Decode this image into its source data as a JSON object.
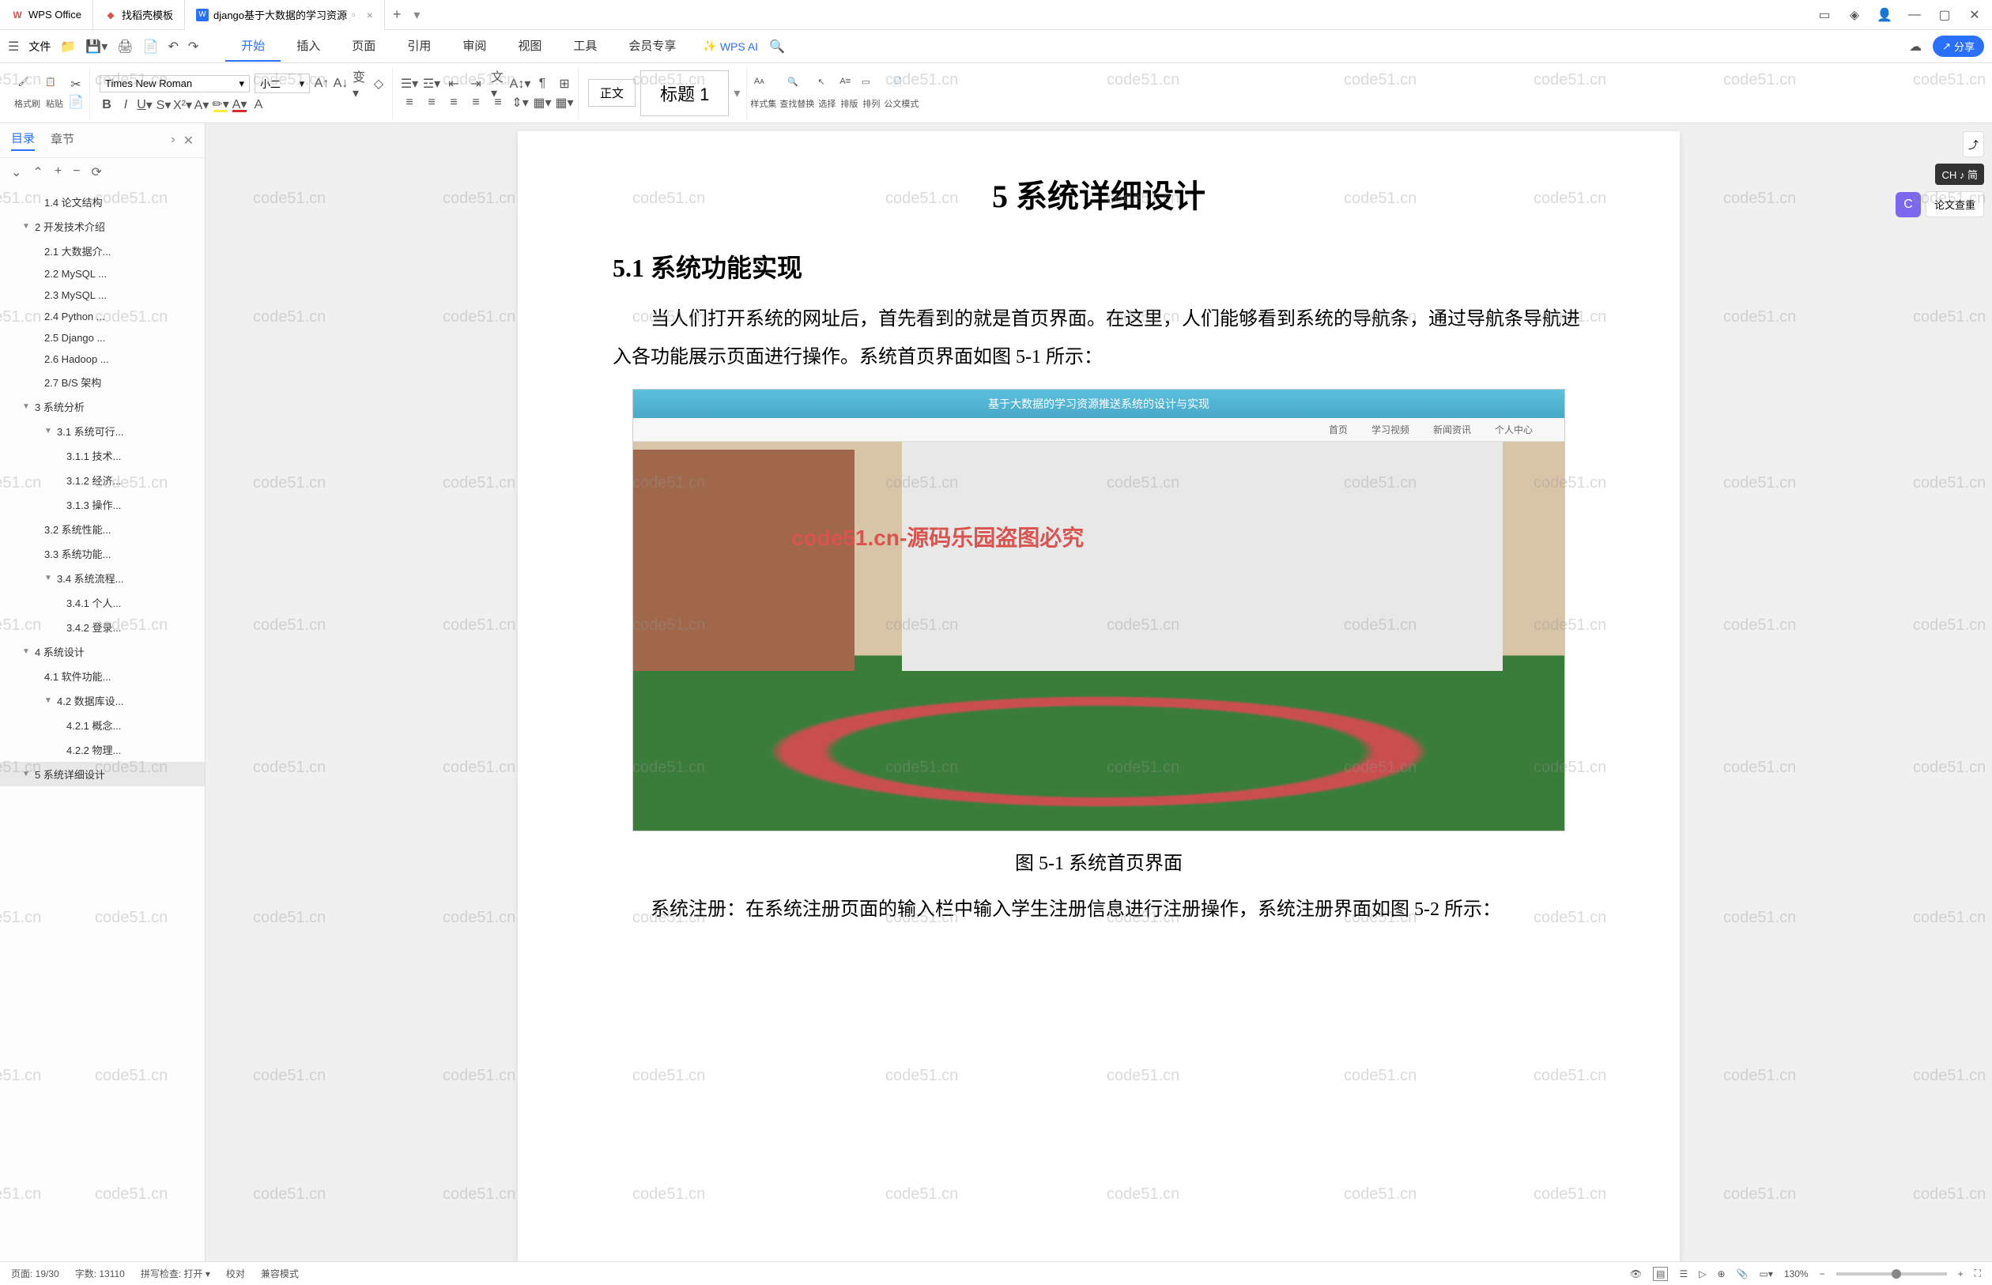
{
  "titlebar": {
    "app_name": "WPS Office",
    "tab_templates": "找稻壳模板",
    "tab_doc": "django基于大数据的学习资源",
    "add": "+"
  },
  "menubar": {
    "file": "文件",
    "tabs": [
      "开始",
      "插入",
      "页面",
      "引用",
      "审阅",
      "视图",
      "工具",
      "会员专享"
    ],
    "active_index": 0,
    "wps_ai": "WPS AI",
    "share": "分享"
  },
  "ribbon": {
    "format_painter": "格式刷",
    "paste": "粘贴",
    "font_name": "Times New Roman",
    "font_size": "小二",
    "style_normal": "正文",
    "style_heading": "标题 1",
    "styles": "样式集",
    "find_replace": "查找替换",
    "select": "选择",
    "arrange": "排版",
    "sort": "排列",
    "doc_mode": "公文模式"
  },
  "sidebar": {
    "tab_toc": "目录",
    "tab_chapter": "章节",
    "items": [
      {
        "level": 2,
        "text": "1.4 论文结构"
      },
      {
        "level": 1,
        "text": "2 开发技术介绍",
        "arrow": true
      },
      {
        "level": 2,
        "text": "2.1 大数据介..."
      },
      {
        "level": 2,
        "text": "2.2 MySQL ..."
      },
      {
        "level": 2,
        "text": "2.3 MySQL ..."
      },
      {
        "level": 2,
        "text": "2.4 Python ..."
      },
      {
        "level": 2,
        "text": "2.5 Django ..."
      },
      {
        "level": 2,
        "text": "2.6 Hadoop ..."
      },
      {
        "level": 2,
        "text": "2.7 B/S 架构"
      },
      {
        "level": 1,
        "text": "3 系统分析",
        "arrow": true
      },
      {
        "level": 2,
        "text": "3.1 系统可行...",
        "arrow": true
      },
      {
        "level": 3,
        "text": "3.1.1 技术..."
      },
      {
        "level": 3,
        "text": "3.1.2 经济..."
      },
      {
        "level": 3,
        "text": "3.1.3 操作..."
      },
      {
        "level": 2,
        "text": "3.2 系统性能..."
      },
      {
        "level": 2,
        "text": "3.3 系统功能..."
      },
      {
        "level": 2,
        "text": "3.4 系统流程...",
        "arrow": true
      },
      {
        "level": 3,
        "text": "3.4.1 个人..."
      },
      {
        "level": 3,
        "text": "3.4.2 登录..."
      },
      {
        "level": 1,
        "text": "4 系统设计",
        "arrow": true
      },
      {
        "level": 2,
        "text": "4.1 软件功能..."
      },
      {
        "level": 2,
        "text": "4.2 数据库设...",
        "arrow": true
      },
      {
        "level": 3,
        "text": "4.2.1 概念..."
      },
      {
        "level": 3,
        "text": "4.2.2 物理..."
      },
      {
        "level": 1,
        "text": "5 系统详细设计",
        "arrow": true,
        "active": true
      }
    ]
  },
  "document": {
    "h1": "5 系统详细设计",
    "h2": "5.1 系统功能实现",
    "p1": "当人们打开系统的网址后，首先看到的就是首页界面。在这里，人们能够看到系统的导航条，通过导航条导航进入各功能展示页面进行操作。系统首页界面如图 5-1 所示：",
    "caption": "图 5-1  系统首页界面",
    "p2": "系统注册：在系统注册页面的输入栏中输入学生注册信息进行注册操作，系统注册界面如图 5-2 所示：",
    "img_title": "基于大数据的学习资源推送系统的设计与实现",
    "img_nav": [
      "首页",
      "学习视频",
      "新闻资讯",
      "个人中心"
    ],
    "img_watermark": "code51.cn-源码乐园盗图必究"
  },
  "right_panel": {
    "ime": "CH ♪ 简",
    "review": "论文查重"
  },
  "statusbar": {
    "page": "页面: 19/30",
    "words": "字数: 13110",
    "spell": "拼写检查: 打开",
    "proof": "校对",
    "compat": "兼容模式",
    "zoom": "130%"
  },
  "watermark": "code51.cn"
}
